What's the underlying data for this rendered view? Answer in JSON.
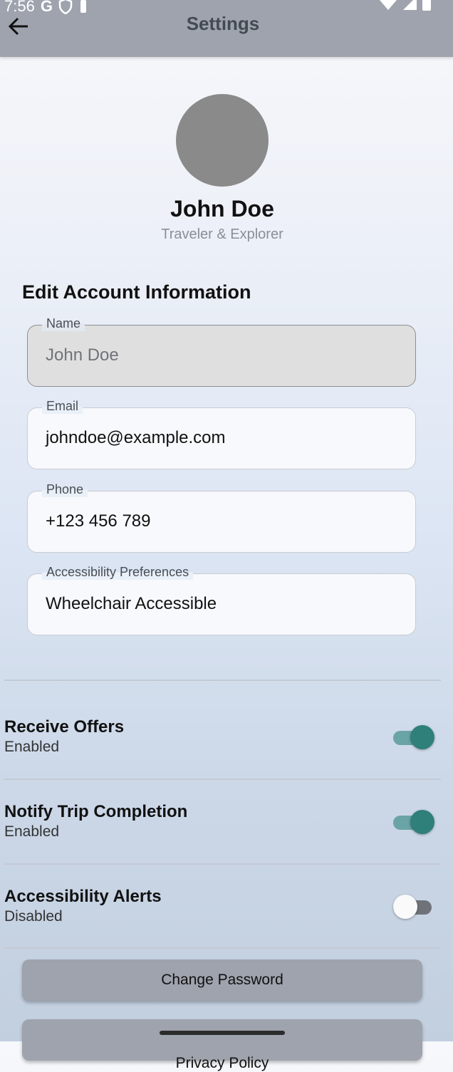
{
  "status_bar": {
    "time": "7:56"
  },
  "header": {
    "title": "Settings"
  },
  "profile": {
    "name": "John Doe",
    "tagline": "Traveler & Explorer"
  },
  "section_title": "Edit Account Information",
  "fields": [
    {
      "label": "Name",
      "value": "John Doe"
    },
    {
      "label": "Email",
      "value": "johndoe@example.com"
    },
    {
      "label": "Phone",
      "value": "+123 456 789"
    },
    {
      "label": "Accessibility Preferences",
      "value": "Wheelchair Accessible"
    }
  ],
  "toggles": [
    {
      "label": "Receive Offers",
      "state": "Enabled",
      "on": true
    },
    {
      "label": "Notify Trip Completion",
      "state": "Enabled",
      "on": true
    },
    {
      "label": "Accessibility Alerts",
      "state": "Disabled",
      "on": false
    }
  ],
  "buttons": {
    "change_password": "Change Password",
    "privacy_policy": "Privacy Policy"
  },
  "colors": {
    "header_bg": "#9ea3ad",
    "toggle_on": "#2f7f7a",
    "avatar": "#8a8a8a"
  }
}
